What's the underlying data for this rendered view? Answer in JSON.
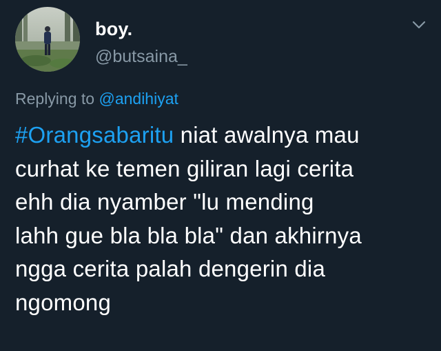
{
  "user": {
    "display_name": "boy.",
    "handle": "@butsaina_"
  },
  "reply": {
    "prefix": "Replying to",
    "mention": "@andihiyat"
  },
  "tweet": {
    "hashtag": "#Orangsabaritu",
    "line1_rest": " niat awalnya mau",
    "line2": "curhat ke temen giliran lagi cerita",
    "line3": "ehh dia nyamber \"lu mending",
    "line4": "lahh gue bla bla bla\" dan akhirnya",
    "line5": "ngga cerita palah dengerin dia",
    "line6": "ngomong"
  },
  "icons": {
    "menu": "chevron-down-icon"
  },
  "colors": {
    "background": "#15202b",
    "accent": "#1da1f2",
    "secondary_text": "#8899a6",
    "primary_text": "#ffffff"
  }
}
